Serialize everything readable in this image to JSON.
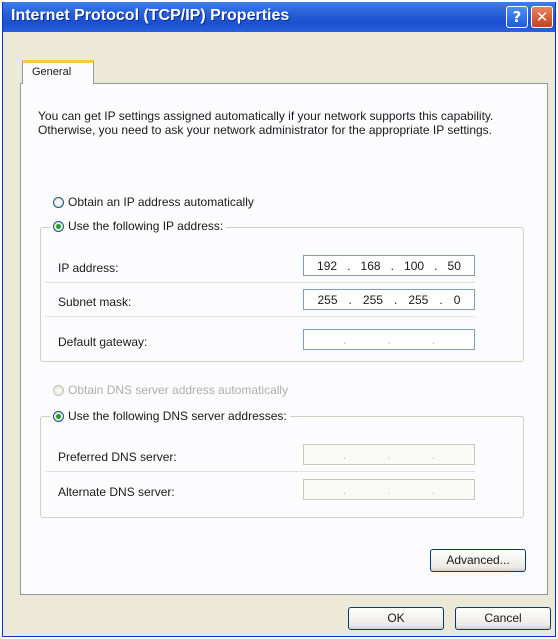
{
  "window": {
    "title": "Internet Protocol (TCP/IP) Properties",
    "help_glyph": "?",
    "close_glyph": "✕"
  },
  "tabs": [
    {
      "label": "General"
    }
  ],
  "description": "You can get IP settings assigned automatically if your network supports this capability. Otherwise, you need to ask your network administrator for the appropriate IP settings.",
  "ip": {
    "auto_label": "Obtain an IP address automatically",
    "manual_label": "Use the following IP address:",
    "selected": "manual",
    "fields": [
      {
        "label": "IP address:",
        "octets": [
          "192",
          "168",
          "100",
          "50"
        ]
      },
      {
        "label": "Subnet mask:",
        "octets": [
          "255",
          "255",
          "255",
          "0"
        ]
      },
      {
        "label": "Default gateway:",
        "octets": [
          "",
          "",
          "",
          ""
        ]
      }
    ]
  },
  "dns": {
    "auto_label": "Obtain DNS server address automatically",
    "manual_label": "Use the following DNS server addresses:",
    "selected": "manual",
    "auto_disabled": true,
    "fields": [
      {
        "label": "Preferred DNS server:",
        "octets": [
          "",
          "",
          "",
          ""
        ]
      },
      {
        "label": "Alternate DNS server:",
        "octets": [
          "",
          "",
          "",
          ""
        ]
      }
    ]
  },
  "buttons": {
    "advanced": "Advanced...",
    "ok": "OK",
    "cancel": "Cancel"
  },
  "ip_separator": "."
}
